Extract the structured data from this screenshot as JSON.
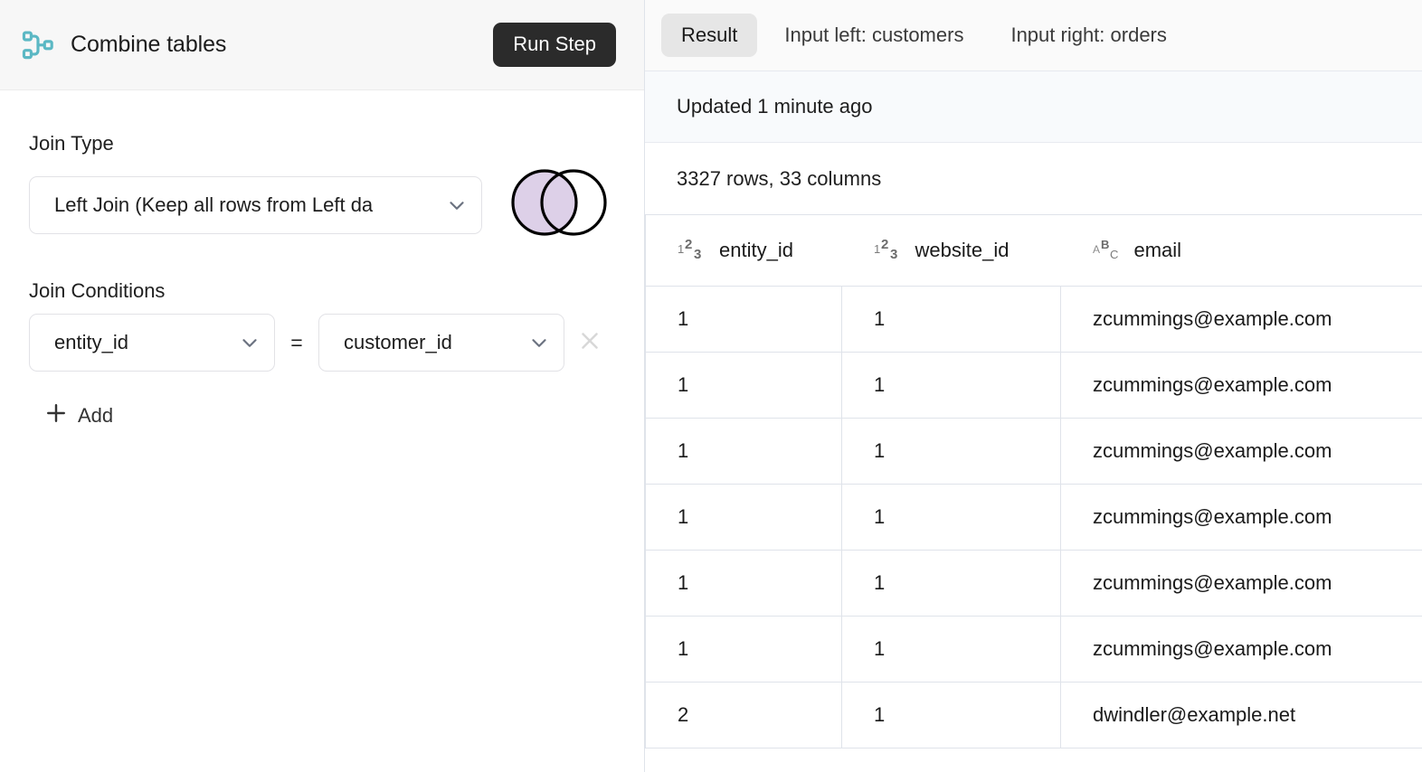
{
  "step": {
    "icon": "workflow-branch-icon",
    "title": "Combine tables",
    "run_label": "Run Step",
    "accent_color": "#5bb8c4",
    "run_button_bg": "#2b2b2b"
  },
  "join": {
    "type_label": "Join Type",
    "type_value": "Left Join (Keep all rows from Left da",
    "venn": {
      "left_fill": "#ddd0e8",
      "right_fill": "#ffffff",
      "stroke": "#000000",
      "kind": "left-join"
    },
    "conditions_label": "Join Conditions",
    "conditions": [
      {
        "left": "entity_id",
        "operator": "=",
        "right": "customer_id"
      }
    ],
    "add_label": "Add"
  },
  "results": {
    "tabs": [
      {
        "label": "Result",
        "active": true
      },
      {
        "label": "Input left: customers",
        "active": false
      },
      {
        "label": "Input right: orders",
        "active": false
      }
    ],
    "updated_text": "Updated 1 minute ago",
    "summary_text": "3327 rows, 33 columns",
    "columns": [
      {
        "name": "entity_id",
        "type_icon": "number-type-icon"
      },
      {
        "name": "website_id",
        "type_icon": "number-type-icon"
      },
      {
        "name": "email",
        "type_icon": "text-type-icon"
      }
    ],
    "rows": [
      [
        "1",
        "1",
        "zcummings@example.com"
      ],
      [
        "1",
        "1",
        "zcummings@example.com"
      ],
      [
        "1",
        "1",
        "zcummings@example.com"
      ],
      [
        "1",
        "1",
        "zcummings@example.com"
      ],
      [
        "1",
        "1",
        "zcummings@example.com"
      ],
      [
        "1",
        "1",
        "zcummings@example.com"
      ],
      [
        "2",
        "1",
        "dwindler@example.net"
      ]
    ]
  }
}
